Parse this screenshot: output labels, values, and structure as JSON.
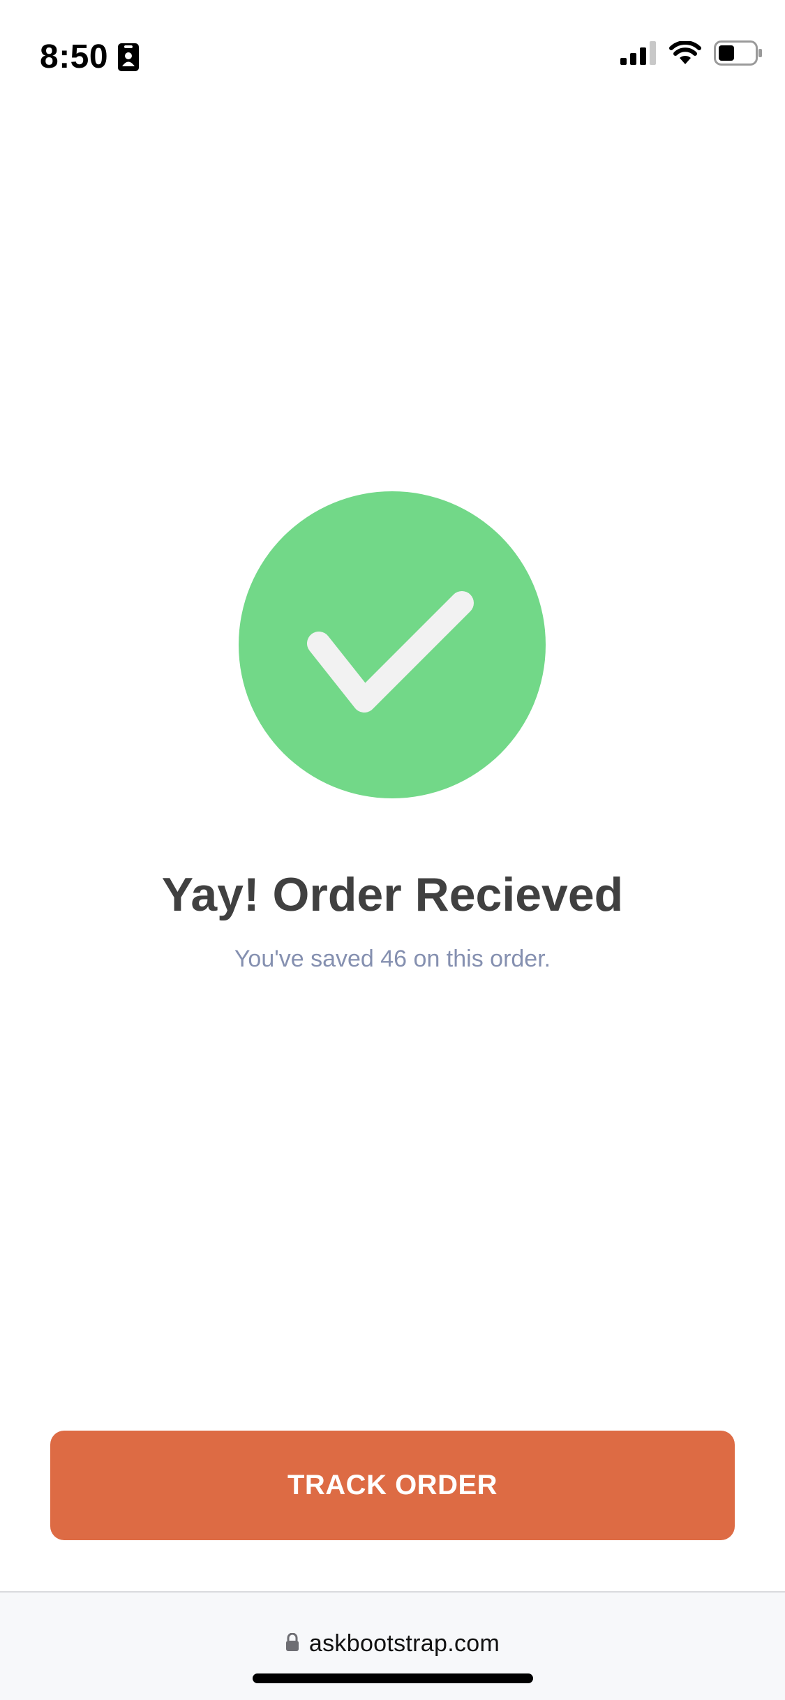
{
  "status_bar": {
    "time": "8:50",
    "icons": [
      "id-card-icon",
      "cellular-signal-icon",
      "wifi-icon",
      "battery-icon"
    ]
  },
  "success": {
    "icon": "checkmark-icon",
    "circle_color": "#72d888",
    "check_color": "#f2f2f2"
  },
  "main": {
    "title": "Yay! Order Recieved",
    "subtitle": "You've saved 46 on this order."
  },
  "actions": {
    "track_button_label": "TRACK ORDER",
    "accent_color": "#dd6b44"
  },
  "browser": {
    "url": "askbootstrap.com",
    "icon": "lock-icon"
  }
}
